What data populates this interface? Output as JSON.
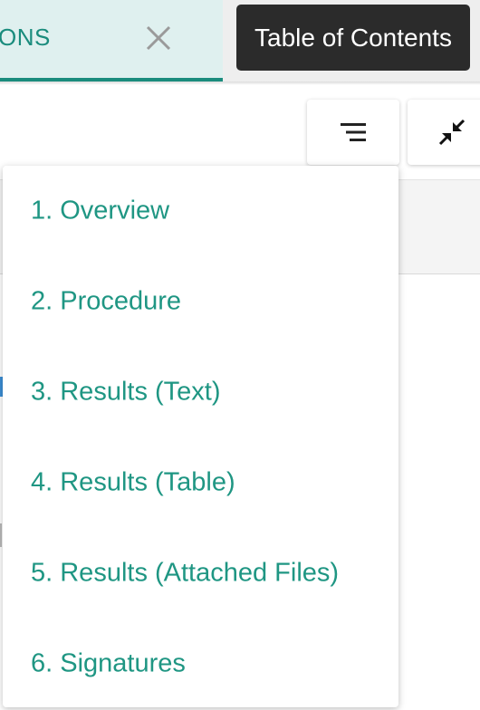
{
  "tab": {
    "label": "ONS",
    "close_icon": "close-icon"
  },
  "tooltip": {
    "text": "Table of Contents"
  },
  "toolbar": {
    "toc_icon": "toc-list-icon",
    "collapse_icon": "collapse-arrows-icon"
  },
  "colors": {
    "accent": "#1a8c7d",
    "link": "#1f9683",
    "tooltip_bg": "#2b2b2b",
    "tab_bg": "#dff0ef"
  },
  "toc": {
    "items": [
      {
        "label": "1. Overview"
      },
      {
        "label": "2. Procedure"
      },
      {
        "label": "3. Results (Text)"
      },
      {
        "label": "4. Results (Table)"
      },
      {
        "label": "5. Results (Attached Files)"
      },
      {
        "label": "6. Signatures"
      }
    ]
  }
}
